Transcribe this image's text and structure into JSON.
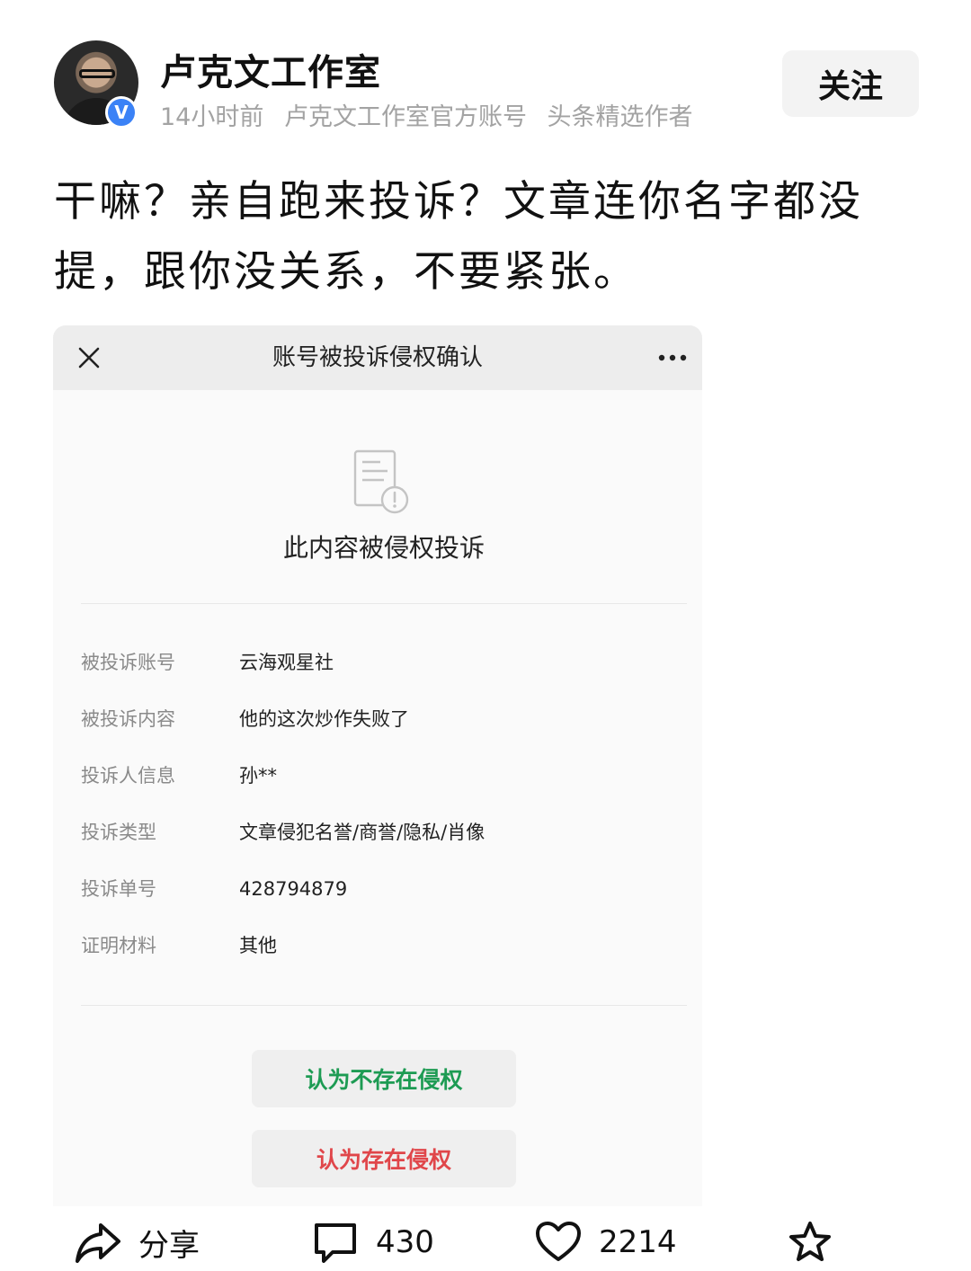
{
  "post": {
    "author_name": "卢克文工作室",
    "verified_badge": "V",
    "meta": {
      "time": "14小时前",
      "account_type": "卢克文工作室官方账号",
      "tag": "头条精选作者"
    },
    "follow_label": "关注",
    "text": "干嘛？亲自跑来投诉？文章连你名字都没提，跟你没关系，不要紧张。"
  },
  "screenshot": {
    "title": "账号被投诉侵权确认",
    "status_title": "此内容被侵权投诉",
    "rows": [
      {
        "label": "被投诉账号",
        "value": "云海观星社"
      },
      {
        "label": "被投诉内容",
        "value": "他的这次炒作失败了"
      },
      {
        "label": "投诉人信息",
        "value": "孙**"
      },
      {
        "label": "投诉类型",
        "value": "文章侵犯名誉/商誉/隐私/肖像"
      },
      {
        "label": "投诉单号",
        "value": "428794879"
      },
      {
        "label": "证明材料",
        "value": "其他"
      }
    ],
    "btn_no_infringement": "认为不存在侵权",
    "btn_infringement": "认为存在侵权"
  },
  "action_bar": {
    "share_label": "分享",
    "comment_count": "430",
    "like_count": "2214"
  },
  "colors": {
    "green_button_text": "#1d9b53",
    "red_button_text": "#e0464a",
    "verified_blue": "#3b82f6"
  }
}
